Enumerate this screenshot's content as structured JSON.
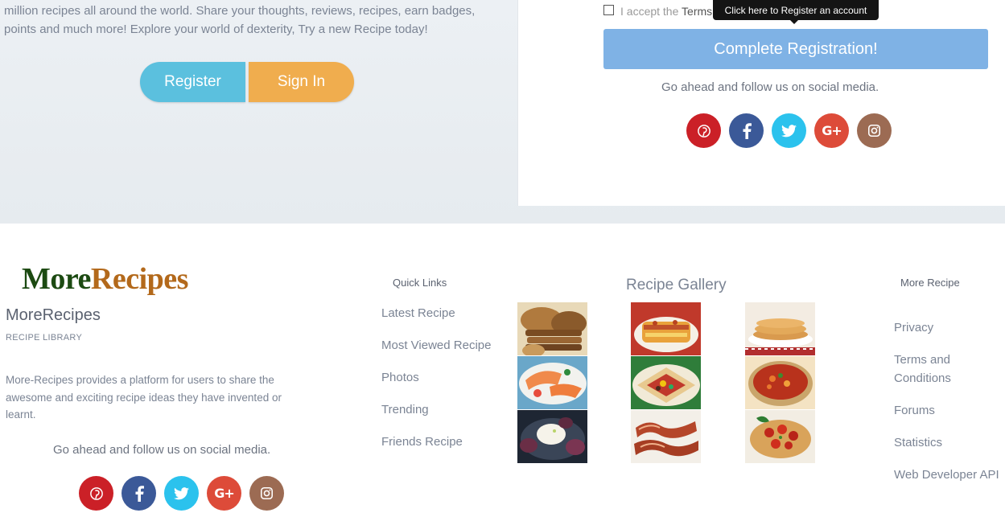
{
  "hero": {
    "text": "million recipes all around the world. Share your thoughts, reviews, recipes, earn badges, points and much more! Explore your world of dexterity, Try a new Recipe today!",
    "register_label": "Register",
    "signin_label": "Sign In"
  },
  "registration": {
    "terms_prefix": "I accept the",
    "terms_link": "Terms",
    "tooltip": "Click here to Register an account",
    "complete_label": "Complete Registration!",
    "follow_text": "Go ahead and follow us on social media."
  },
  "social_icons": [
    "pinterest-icon",
    "facebook-icon",
    "twitter-icon",
    "google-plus-icon",
    "instagram-icon"
  ],
  "social_colors": {
    "pinterest": "#cb2027",
    "facebook": "#3b5998",
    "twitter": "#2bc2ed",
    "google_plus": "#dd4b39",
    "instagram": "#9c6b53"
  },
  "footer": {
    "logo": {
      "more": "More",
      "recipes": "Recipes"
    },
    "brand_name": "MoreRecipes",
    "brand_sub": "RECIPE LIBRARY",
    "description": "More-Recipes provides a platform for users to share the awesome and exciting  recipe ideas they have invented or learnt.",
    "follow_text": "Go ahead and follow us on social media.",
    "quick_links": {
      "title": "Quick Links",
      "items": [
        "Latest Recipe",
        "Most Viewed Recipe",
        "Photos",
        "Trending",
        "Friends Recipe"
      ]
    },
    "gallery": {
      "title": "Recipe Gallery",
      "items": [
        "bread",
        "lasagna",
        "pancakes",
        "salmon",
        "wraps",
        "tomato-soup",
        "cheese-figs",
        "bacon",
        "bruschetta"
      ]
    },
    "more_recipe": {
      "title": "More Recipe",
      "items": [
        "Privacy",
        "Terms and Conditions",
        "Forums",
        "Statistics",
        "Web Developer API"
      ]
    }
  },
  "colors": {
    "register_button": "#5bc0de",
    "signin_button": "#f0ad4e",
    "complete_button": "#7fb2e5",
    "logo_more": "#1c4a12",
    "logo_recipes": "#b3691b"
  }
}
